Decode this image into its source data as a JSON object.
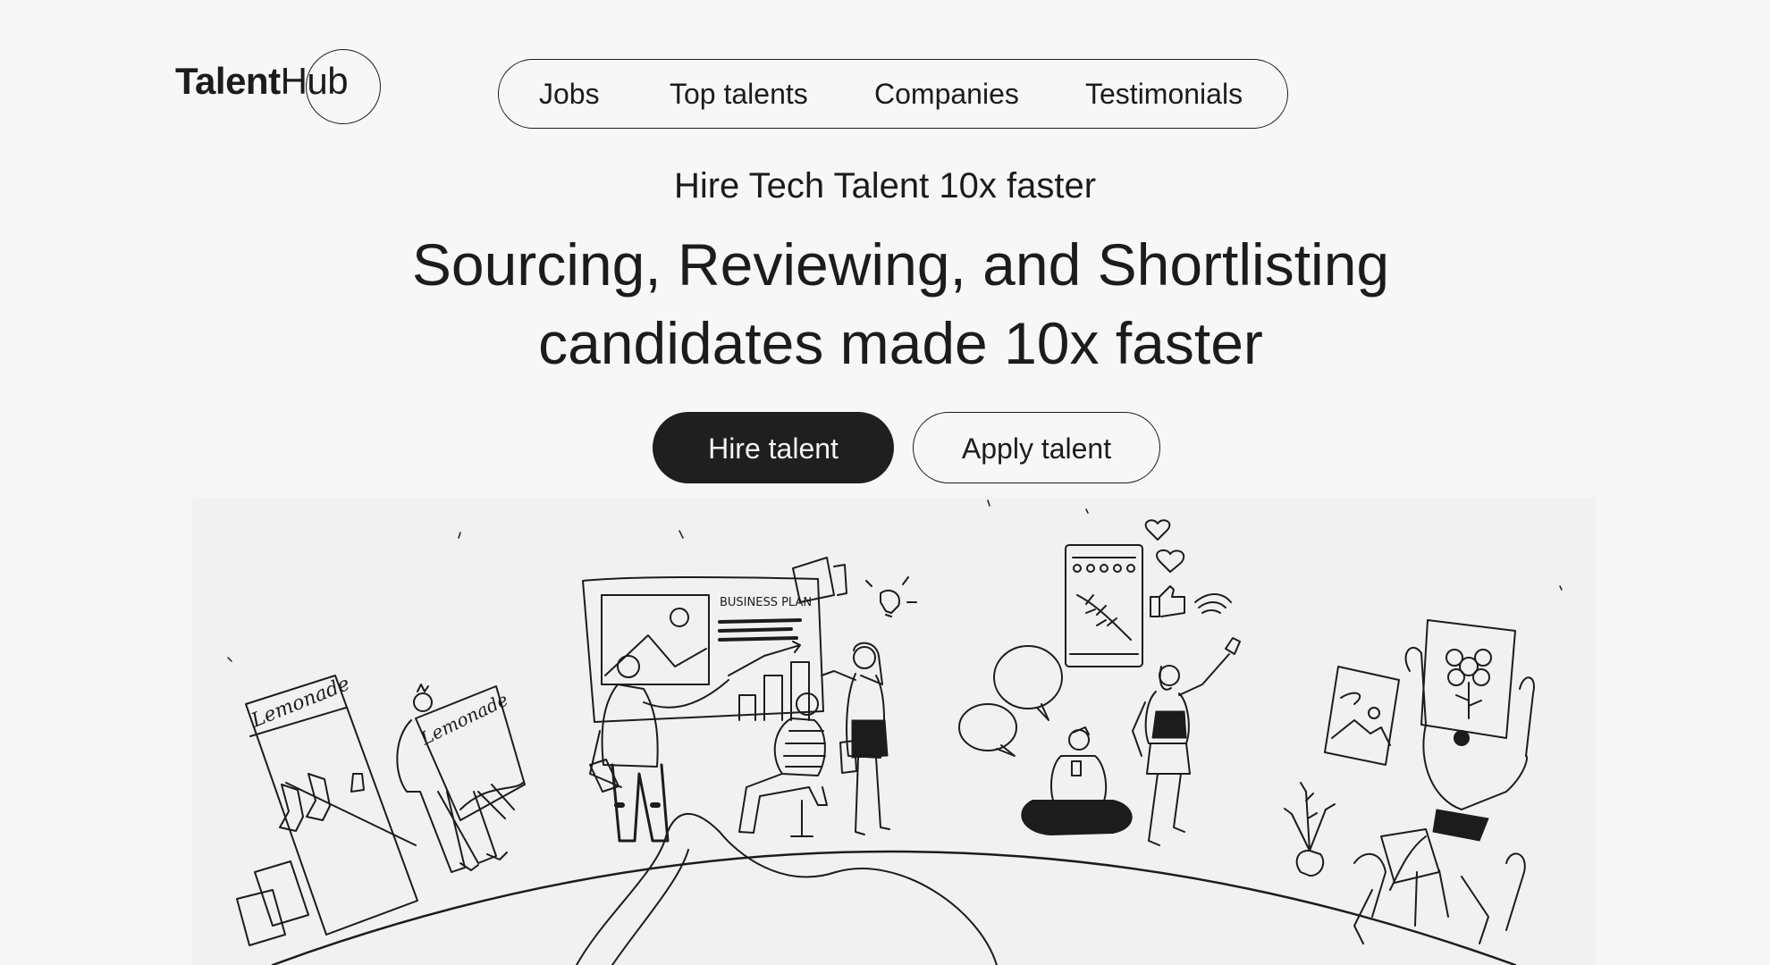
{
  "brand": {
    "name_bold": "Talent",
    "name_light": "Hub"
  },
  "nav": {
    "items": [
      {
        "label": "Jobs"
      },
      {
        "label": "Top talents"
      },
      {
        "label": "Companies"
      },
      {
        "label": "Testimonials"
      }
    ]
  },
  "hero": {
    "eyebrow": "Hire Tech Talent 10x faster",
    "headline_line1": "Sourcing, Reviewing, and Shortlisting",
    "headline_line2": "candidates made 10x faster",
    "primary_button": "Hire talent",
    "secondary_button": "Apply talent"
  },
  "illustration": {
    "stand_sign": "Lemonade",
    "held_sign": "Lemonade",
    "board_title": "BUSINESS PLAN"
  },
  "colors": {
    "background": "#f7f7f7",
    "text": "#1c1c1c",
    "primary_button_bg": "#1f1f1f",
    "primary_button_text": "#f3f3f3"
  }
}
